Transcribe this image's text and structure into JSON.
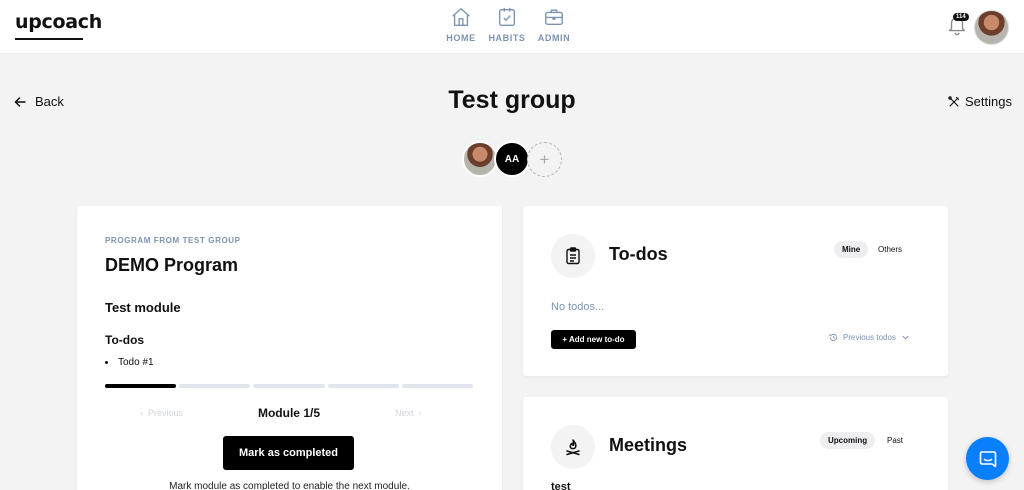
{
  "header": {
    "logo": "upcoach",
    "nav": [
      {
        "label": "HOME",
        "icon": "home-icon"
      },
      {
        "label": "HABITS",
        "icon": "clipboard-check-icon"
      },
      {
        "label": "ADMIN",
        "icon": "briefcase-icon"
      }
    ],
    "notification_count": "114"
  },
  "page": {
    "back_label": "Back",
    "title": "Test group",
    "settings_label": "Settings",
    "member_initials": "AA",
    "add_member_symbol": "+"
  },
  "program": {
    "eyebrow": "PROGRAM FROM TEST GROUP",
    "title": "DEMO Program",
    "module_title": "Test module",
    "todos_heading": "To-dos",
    "todos": [
      "Todo #1"
    ],
    "progress": {
      "completed_segments": 1,
      "total_segments": 5
    },
    "prev_label": "Previous",
    "module_label": "Module 1/5",
    "next_label": "Next",
    "mark_button": "Mark as completed",
    "hint": "Mark module as completed to enable the next module."
  },
  "todos_card": {
    "title": "To-dos",
    "filters": [
      "Mine",
      "Others"
    ],
    "active_filter": "Mine",
    "empty_text": "No todos...",
    "add_button": "+ Add new to-do",
    "previous_label": "Previous todos"
  },
  "meetings_card": {
    "title": "Meetings",
    "filters": [
      "Upcoming",
      "Past"
    ],
    "active_filter": "Upcoming",
    "first_item": "test"
  },
  "colors": {
    "accent_muted": "#7c93b0",
    "chat_button": "#0a7ffb",
    "primary_button": "#000000"
  }
}
